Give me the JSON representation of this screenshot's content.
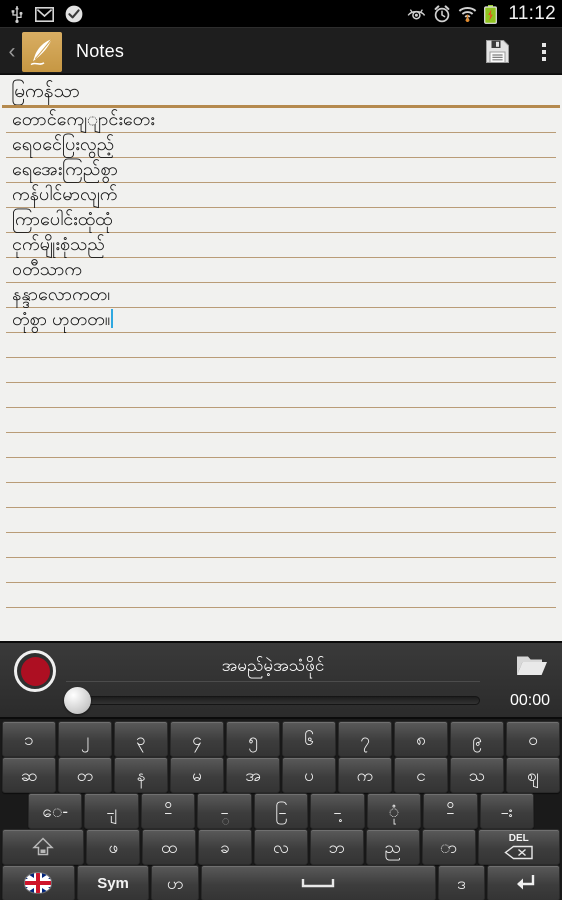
{
  "statusbar": {
    "left_icons": [
      "usb-icon",
      "gmail-icon",
      "check-badge-icon"
    ],
    "right_icons": [
      "eye-icon",
      "alarm-clock-icon",
      "wifi-icon",
      "battery-charging-icon"
    ],
    "clock": "11:12"
  },
  "actionbar": {
    "back_glyph": "‹",
    "app_icon": "feather-quill-icon",
    "title": "Notes",
    "save_icon": "floppy-save-icon",
    "overflow_icon": "overflow-menu-icon"
  },
  "note": {
    "title": "မြကန်သာ",
    "lines": [
      "တောင်ကျေျာင်းတေး",
      "ရေဝင်ေပြးလွည့်",
      "ရေအေးကြည်စွာ",
      "ကန်ပါင်မာလျက်",
      "ကြာပေါင်းထုံထုံ",
      "ငုက်မျိုးစုံသည်",
      "ဝတီသာက",
      "နန္ဒာလောကတ၊",
      "တုံစွာ ဟုတတ။"
    ],
    "caret_line_index": 8,
    "blank_lines": 11,
    "rule_color": "#b99c77",
    "paper_color": "#f1f1ef",
    "title_rule_color": "#b58a4e"
  },
  "recorder": {
    "record_icon": "record-circle-icon",
    "record_color": "#ad0f22",
    "file_name": "အမည်မဲ့အသံဖိုင်",
    "folder_icon": "open-folder-icon",
    "elapsed_time": "00:00",
    "seek_position_percent": 0
  },
  "keyboard": {
    "row1": [
      "၁",
      "၂",
      "၃",
      "၄",
      "၅",
      "၆",
      "၇",
      "၈",
      "၉",
      "၀"
    ],
    "row2": [
      "ဆ",
      "တ",
      "န",
      "မ",
      "အ",
      "ပ",
      "က",
      "င",
      "သ",
      "ဈ"
    ],
    "row3": [
      "ေ-",
      "-ျ",
      "-ိ",
      "-္",
      "-ြ",
      "-့",
      "ုံ",
      "-ိ",
      "-း"
    ],
    "row4_shift": "shift-icon",
    "row4": [
      "ဖ",
      "ထ",
      "ခ",
      "လ",
      "ဘ",
      "ည",
      "ာ"
    ],
    "row4_del": {
      "label": "DEL",
      "icon": "backspace-icon"
    },
    "row5": {
      "language_icon": "uk-flag-icon",
      "sym": "Sym",
      "extra_key": "ဟ",
      "space_icon": "space-bar-icon",
      "right_key": "ဒ",
      "enter_icon": "enter-return-icon"
    }
  }
}
